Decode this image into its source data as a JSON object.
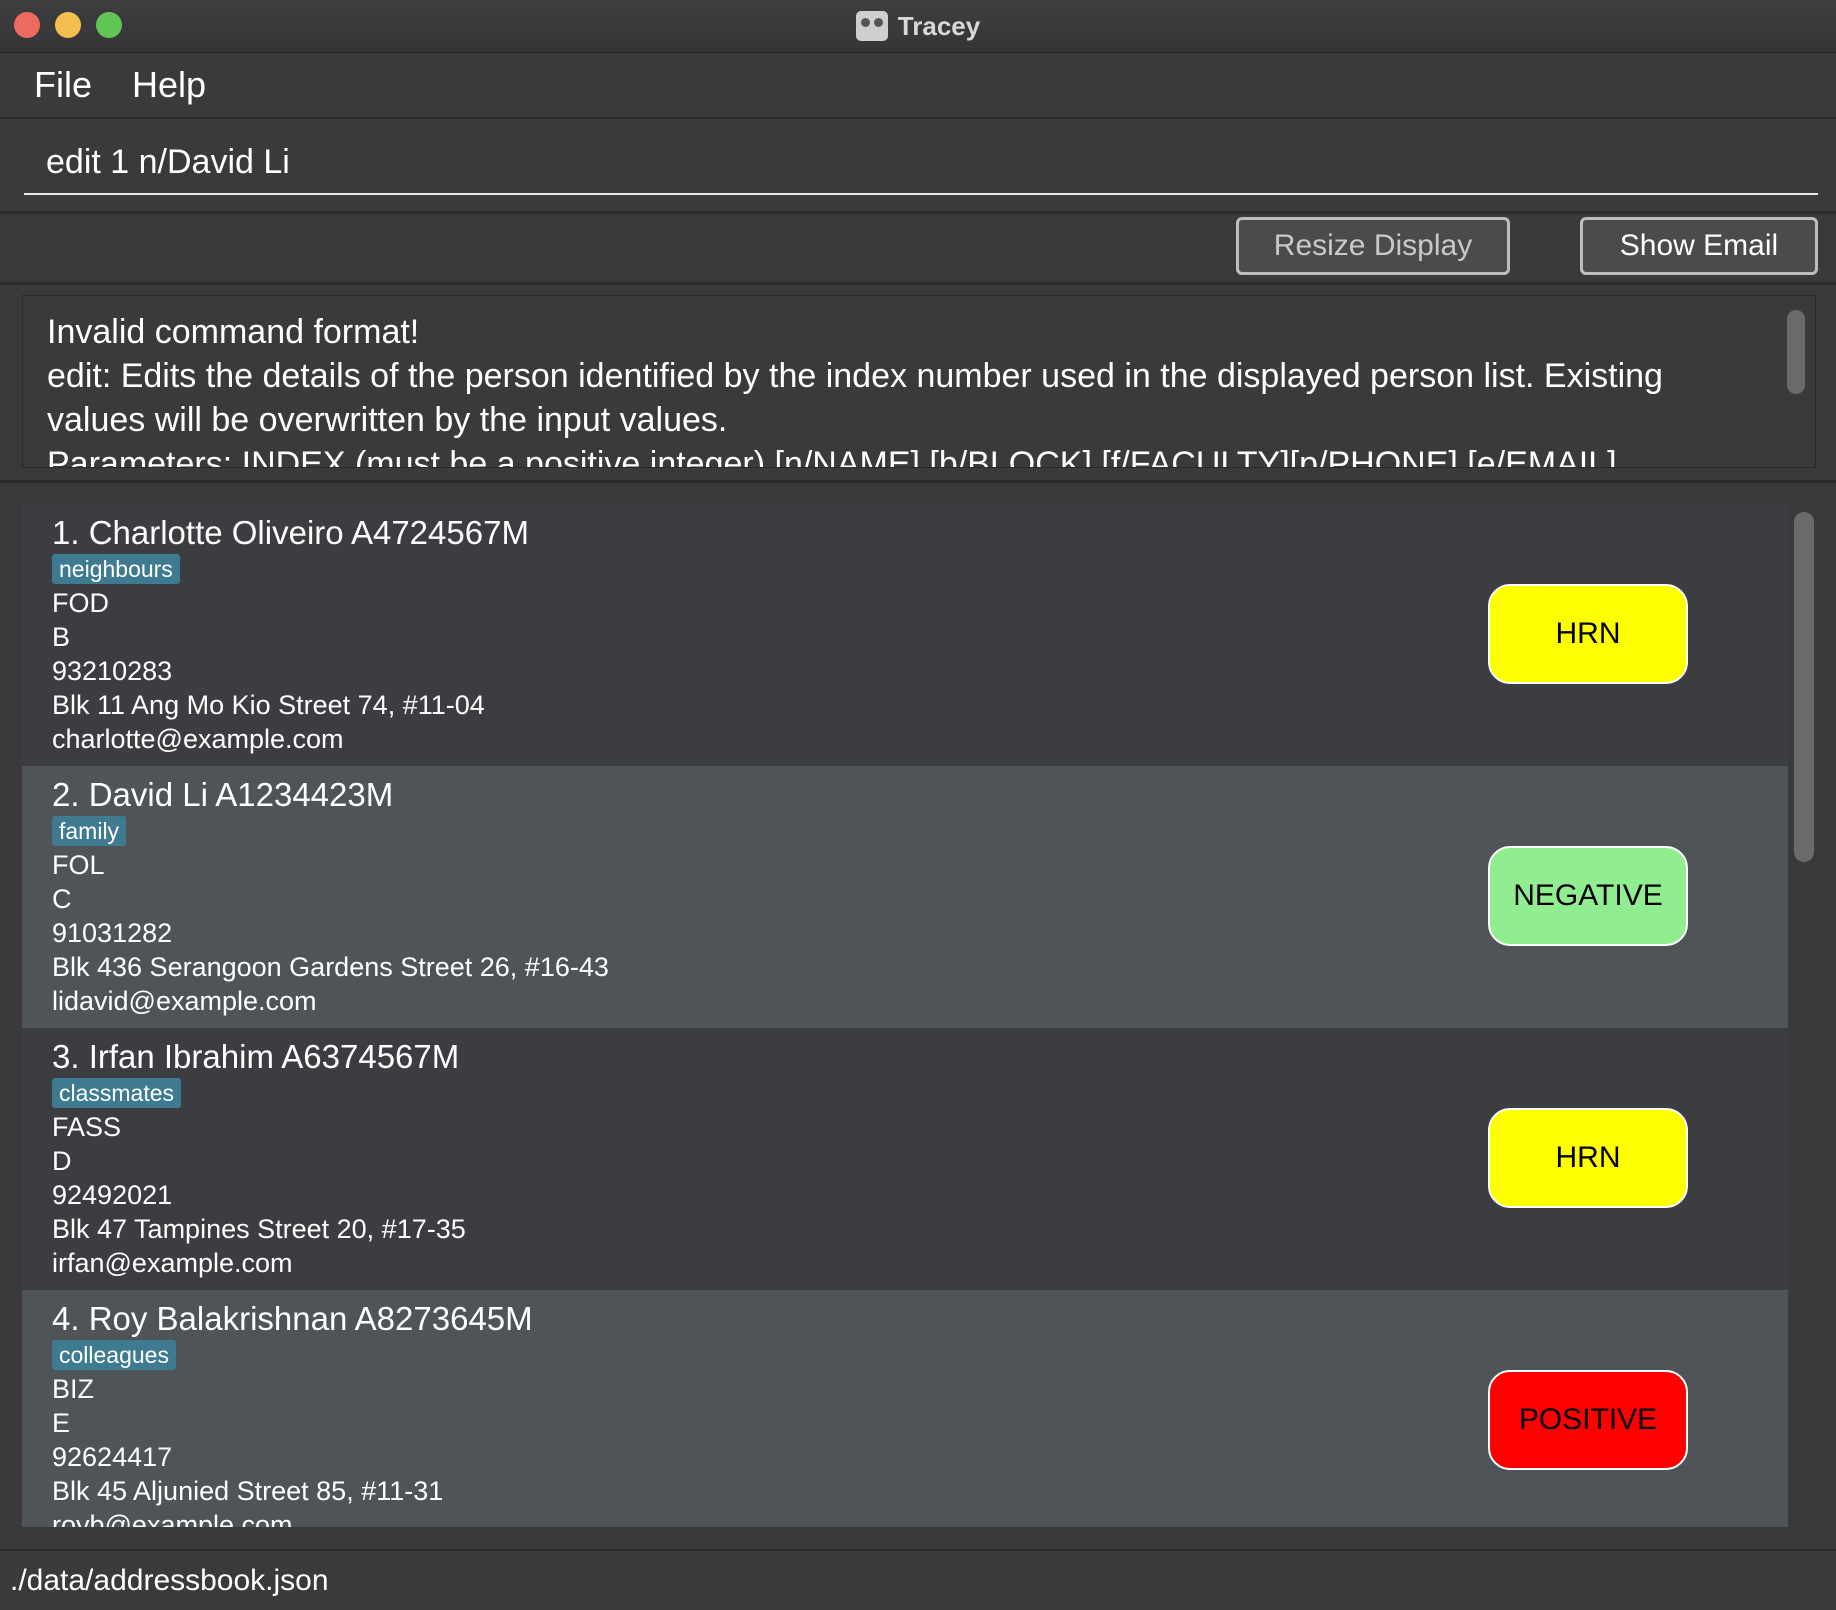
{
  "window": {
    "title": "Tracey"
  },
  "menu": {
    "file": "File",
    "help": "Help"
  },
  "command": {
    "value": "edit 1 n/David Li"
  },
  "toolbar": {
    "resize_label": "Resize Display",
    "email_label": "Show Email"
  },
  "result": {
    "text": "Invalid command format!\nedit: Edits the details of the person identified by the index number used in the displayed person list. Existing values will be overwritten by the input values.\nParameters: INDEX (must be a positive integer) [n/NAME] [b/BLOCK] [f/FACULTY][p/PHONE] [e/EMAIL]"
  },
  "persons": [
    {
      "name": "1.  Charlotte Oliveiro A4724567M",
      "tag": "neighbours",
      "faculty": "FOD",
      "block": "B",
      "phone": "93210283",
      "address": "Blk 11 Ang Mo Kio Street 74, #11-04",
      "email": "charlotte@example.com",
      "status": "HRN",
      "status_color": "#ffff00"
    },
    {
      "name": "2.  David Li A1234423M",
      "tag": "family",
      "faculty": "FOL",
      "block": "C",
      "phone": "91031282",
      "address": "Blk 436 Serangoon Gardens Street 26, #16-43",
      "email": "lidavid@example.com",
      "status": "NEGATIVE",
      "status_color": "#90ee90"
    },
    {
      "name": "3.  Irfan Ibrahim A6374567M",
      "tag": "classmates",
      "faculty": "FASS",
      "block": "D",
      "phone": "92492021",
      "address": "Blk 47 Tampines Street 20, #17-35",
      "email": "irfan@example.com",
      "status": "HRN",
      "status_color": "#ffff00"
    },
    {
      "name": "4.  Roy Balakrishnan A8273645M",
      "tag": "colleagues",
      "faculty": "BIZ",
      "block": "E",
      "phone": "92624417",
      "address": "Blk 45 Aljunied Street 85, #11-31",
      "email": "royb@example.com",
      "status": "POSITIVE",
      "status_color": "#ff0000"
    }
  ],
  "statusbar": {
    "path": "./data/addressbook.json"
  },
  "colors": {
    "tag_bg": "#3e7b91",
    "card_odd": "#3b3d40",
    "card_even": "#4f5458"
  }
}
